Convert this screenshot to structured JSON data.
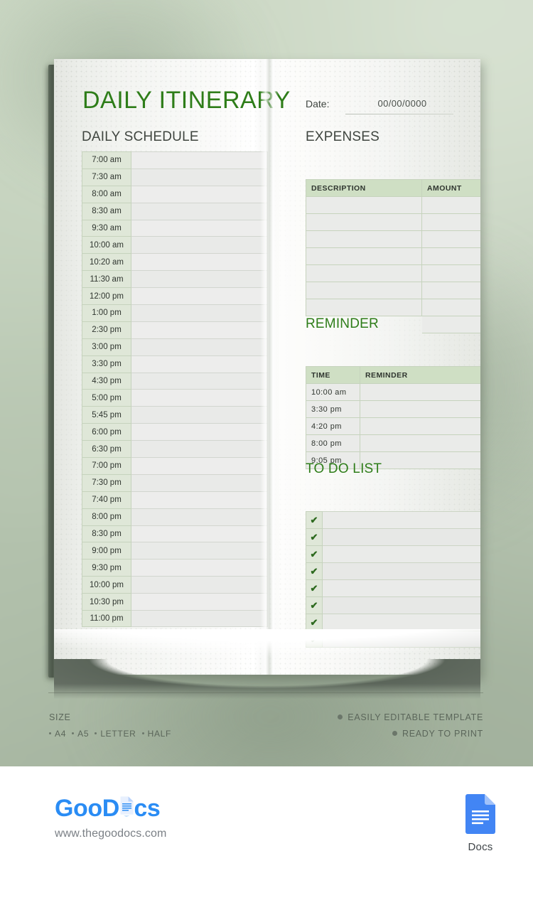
{
  "document": {
    "title": "DAILY ITINERARY",
    "date_label": "Date:",
    "date_value": "00/00/0000"
  },
  "schedule": {
    "heading": "DAILY SCHEDULE",
    "times": [
      "7:00 am",
      "7:30 am",
      "8:00 am",
      "8:30 am",
      "9:30 am",
      "10:00 am",
      "10:20 am",
      "11:30 am",
      "12:00 pm",
      "1:00 pm",
      "2:30 pm",
      "3:00 pm",
      "3:30 pm",
      "4:30 pm",
      "5:00 pm",
      "5:45 pm",
      "6:00 pm",
      "6:30 pm",
      "7:00 pm",
      "7:30 pm",
      "7:40 pm",
      "8:00 pm",
      "8:30 pm",
      "9:00 pm",
      "9:30 pm",
      "10:00 pm",
      "10:30 pm",
      "11:00 pm"
    ],
    "notes": [
      "",
      "",
      "",
      "",
      "",
      "",
      "",
      "",
      "",
      "",
      "",
      "",
      "",
      "",
      "",
      "",
      "",
      "",
      "",
      "",
      "",
      "",
      "",
      "",
      "",
      "",
      "",
      ""
    ]
  },
  "expenses": {
    "heading": "EXPENSES",
    "columns": [
      "DESCRIPTION",
      "AMOUNT"
    ],
    "rows": [
      [
        "",
        ""
      ],
      [
        "",
        ""
      ],
      [
        "",
        ""
      ],
      [
        "",
        ""
      ],
      [
        "",
        ""
      ],
      [
        "",
        ""
      ],
      [
        "",
        ""
      ],
      [
        "",
        ""
      ]
    ]
  },
  "reminder": {
    "heading": "REMINDER",
    "columns": [
      "TIME",
      "REMINDER"
    ],
    "rows": [
      [
        "10:00 am",
        ""
      ],
      [
        "3:30 pm",
        ""
      ],
      [
        "4:20 pm",
        ""
      ],
      [
        "8:00 pm",
        ""
      ],
      [
        "9:05 pm",
        ""
      ]
    ]
  },
  "todo": {
    "heading": "TO DO LIST",
    "check_glyph": "✔",
    "items": [
      "",
      "",
      "",
      "",
      "",
      "",
      "",
      ""
    ]
  },
  "info": {
    "size_label": "SIZE",
    "sizes": [
      "A4",
      "A5",
      "LETTER",
      "HALF"
    ],
    "features": [
      "EASILY EDITABLE TEMPLATE",
      "READY TO PRINT"
    ]
  },
  "brand": {
    "name_part1": "Goo",
    "name_part2": "Docs",
    "url": "www.thegoodocs.com",
    "docs_label": "Docs"
  },
  "colors": {
    "title_green": "#2e7d19",
    "header_fill": "#cfdfc4",
    "time_fill": "#dfe7d8",
    "border_green": "#c6d3bd",
    "brand_blue": "#2a8cf4",
    "docs_blue": "#4285f4"
  }
}
